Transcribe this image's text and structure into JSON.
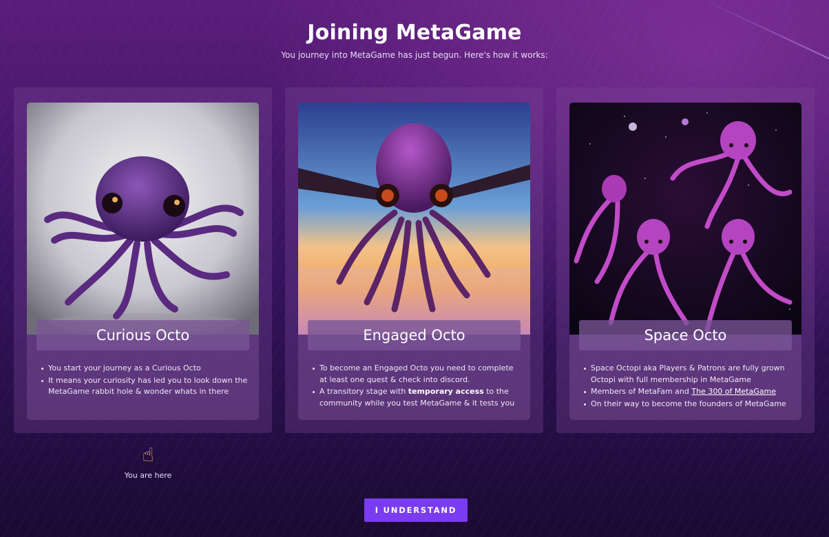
{
  "header": {
    "title": "Joining MetaGame",
    "subtitle": "You journey into MetaGame has just begun. Here's how it works:"
  },
  "cards": [
    {
      "name": "Curious Octo",
      "bullets": [
        "You start your journey as a Curious Octo",
        "It means your curiosity has led you to look down the MetaGame rabbit hole & wonder whats in there"
      ]
    },
    {
      "name": "Engaged Octo",
      "bullets": [
        "To become an Engaged Octo you need to complete at least one quest & check into discord."
      ],
      "bullet2": {
        "before": "A transitory stage with ",
        "bold": "temporary access",
        "after": " to the community while you test MetaGame & it tests you"
      }
    },
    {
      "name": "Space Octo",
      "bullets": [
        "Space Octopi aka Players & Patrons are fully grown Octopi with full membership in MetaGame",
        "On their way to become the founders of MetaGame"
      ],
      "bullet_link": {
        "before": "Members of MetaFam and ",
        "link": "The 300 of MetaGame"
      }
    }
  ],
  "marker": {
    "icon": "pointing-up-hand-icon",
    "glyph": "☝",
    "label": "You are here"
  },
  "actions": {
    "understand_label": "I UNDERSTAND"
  },
  "colors": {
    "accent": "#7a3cf0",
    "background_top": "#5b1d7a",
    "background_bottom": "#1b0a33"
  }
}
